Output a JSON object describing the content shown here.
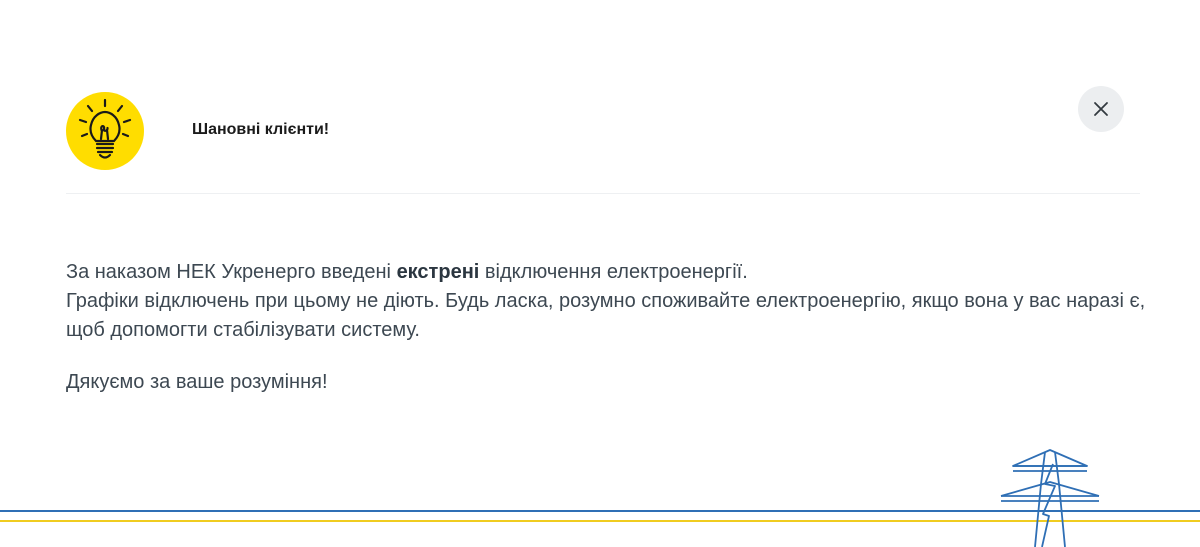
{
  "header": {
    "title": "Шановні клієнти!",
    "icon": "lightbulb-icon"
  },
  "close_button": {
    "icon": "close-icon"
  },
  "message": {
    "line1_prefix": "За наказом НЕК Укренерго введені ",
    "line1_bold": "екстрені",
    "line1_suffix": " відключення електроенергії.",
    "line2": "Графіки відключень при цьому не діють.  Будь ласка, розумно споживайте електроенергію, якщо вона у вас наразі є, щоб допомогти стабілізувати систему.",
    "thanks": "Дякуємо за ваше розуміння!"
  },
  "decoration": {
    "pylon_icon": "power-pylon-icon",
    "colors": {
      "badge_yellow": "#ffdd00",
      "stripe_blue": "#2f6fb5",
      "stripe_yellow": "#f0cc20"
    }
  }
}
